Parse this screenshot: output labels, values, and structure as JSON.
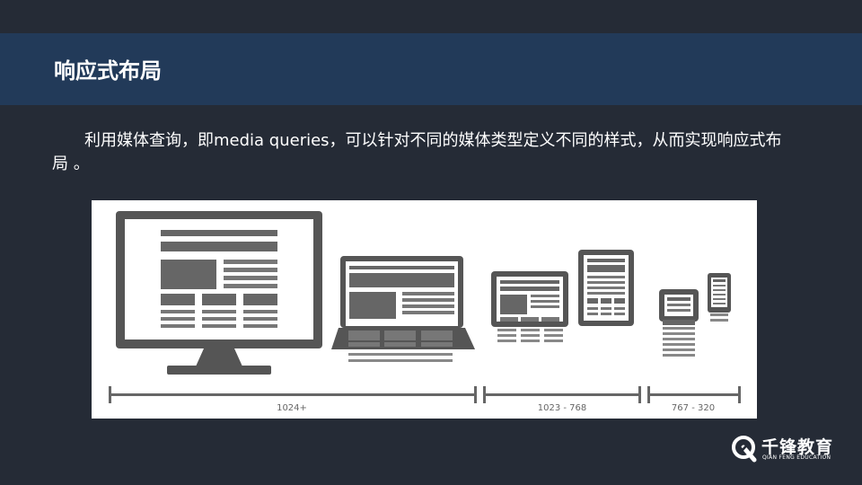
{
  "slide": {
    "title": "响应式布局",
    "paragraph": "利用媒体查询，即media queries，可以针对不同的媒体类型定义不同的样式，从而实现响应式布局 。"
  },
  "figure": {
    "ranges": [
      {
        "label": "1024+"
      },
      {
        "label": "1023 - 768"
      },
      {
        "label": "767 - 320"
      }
    ],
    "devices": [
      "desktop-monitor-icon",
      "laptop-icon",
      "tablet-landscape-icon",
      "tablet-portrait-icon",
      "phone-landscape-icon",
      "phone-portrait-icon"
    ]
  },
  "logo": {
    "name": "千锋教育",
    "subtitle": "QIAN FENG EDUCATION"
  },
  "colors": {
    "background": "#252b36",
    "title_bar": "#223a59",
    "text": "#ffffff",
    "device_gray": "#555555"
  }
}
